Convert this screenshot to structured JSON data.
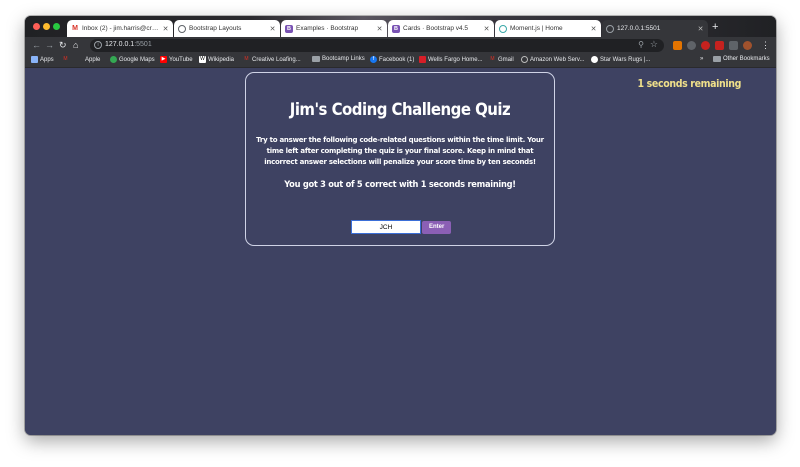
{
  "browser": {
    "tabs": [
      {
        "title": "Inbox (2) - jim.harris@creativ...",
        "favicon": "gmail-icon",
        "color": "#d93025",
        "glyph": "M"
      },
      {
        "title": "Bootstrap Layouts",
        "favicon": "globe-icon",
        "color": "#5f6368",
        "glyph": ""
      },
      {
        "title": "Examples · Bootstrap",
        "favicon": "bootstrap-icon",
        "color": "#7952b3",
        "glyph": "B"
      },
      {
        "title": "Cards · Bootstrap v4.5",
        "favicon": "bootstrap-icon",
        "color": "#7952b3",
        "glyph": "B"
      },
      {
        "title": "Moment.js | Home",
        "favicon": "moment-icon",
        "color": "#3aa8a8",
        "glyph": "◷"
      },
      {
        "title": "127.0.0.1:5501",
        "favicon": "globe-icon",
        "color": "#5f6368",
        "glyph": ""
      }
    ],
    "address": {
      "host": "127.0.0.1",
      "port": ":5501"
    },
    "bookmarks": [
      {
        "label": "Apps",
        "icon": "apps-icon"
      },
      {
        "label": "",
        "icon": "gmail-icon"
      },
      {
        "label": "Apple",
        "icon": "apple-icon"
      },
      {
        "label": "Google Maps",
        "icon": "maps-icon"
      },
      {
        "label": "YouTube",
        "icon": "youtube-icon"
      },
      {
        "label": "Wikipedia",
        "icon": "wikipedia-icon"
      },
      {
        "label": "Creative Loafing...",
        "icon": "gmail-icon"
      },
      {
        "label": "Bootcamp Links",
        "icon": "folder-icon"
      },
      {
        "label": "Facebook (1)",
        "icon": "facebook-icon"
      },
      {
        "label": "Wells Fargo Home...",
        "icon": "wellsfargo-icon"
      },
      {
        "label": "Gmail",
        "icon": "gmail-icon"
      },
      {
        "label": "Amazon Web Serv...",
        "icon": "globe-icon"
      },
      {
        "label": "Star Wars Rugs |...",
        "icon": "globe-icon"
      }
    ],
    "overflow_label": "»",
    "other_bookmarks": "Other Bookmarks"
  },
  "quiz": {
    "timer_text": "1 seconds remaining",
    "title": "Jim's Coding Challenge Quiz",
    "intro": "Try to answer the following code-related questions within the time limit. Your time left after completing the quiz is your final score. Keep in mind that incorrect answer selections will penalize your score time by ten seconds!",
    "result": "You got 3 out of 5 correct with 1 seconds remaining!",
    "initials_value": "JCH",
    "enter_label": "Enter"
  }
}
